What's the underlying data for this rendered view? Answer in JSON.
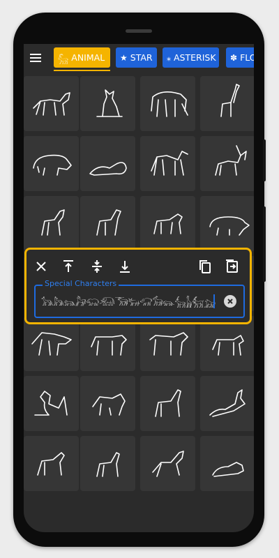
{
  "tabs": [
    {
      "icon": "goat-icon",
      "glyph": "𓃵",
      "label": "ANIMAL",
      "active": true
    },
    {
      "icon": "star-icon",
      "glyph": "★",
      "label": "STAR",
      "active": false
    },
    {
      "icon": "asterisk-icon",
      "glyph": "⁎",
      "label": "ASTERISK",
      "active": false
    },
    {
      "icon": "flower-icon",
      "glyph": "✽",
      "label": "FLO",
      "active": false
    }
  ],
  "grid": {
    "items": [
      {
        "icon": "jackal-icon"
      },
      {
        "icon": "seated-cat-icon"
      },
      {
        "icon": "elephant-icon"
      },
      {
        "icon": "giraffe-icon"
      },
      {
        "icon": "hippopotamus-icon"
      },
      {
        "icon": "lying-lion-icon"
      },
      {
        "icon": "monkey-icon"
      },
      {
        "icon": "ibex-icon"
      },
      {
        "icon": "horse-icon"
      },
      {
        "icon": "donkey-icon"
      },
      {
        "icon": "hound-icon"
      },
      {
        "icon": "pig-icon"
      },
      {
        "icon": "leaping-antelope-icon"
      },
      {
        "icon": "lying-oryx-icon"
      },
      {
        "icon": "lying-bull-icon"
      },
      {
        "icon": "gazelle-icon"
      },
      {
        "icon": "hartebeest-icon"
      },
      {
        "icon": "cow-icon"
      },
      {
        "icon": "ox-icon"
      },
      {
        "icon": "calf-icon"
      },
      {
        "icon": "seated-figure-icon"
      },
      {
        "icon": "cow-suckling-calf-icon"
      },
      {
        "icon": "set-animal-icon"
      },
      {
        "icon": "recumbent-jackal-icon"
      },
      {
        "icon": "giraffe-standing-icon"
      },
      {
        "icon": "antelope-icon"
      },
      {
        "icon": "deer-icon"
      },
      {
        "icon": "dog-icon"
      }
    ]
  },
  "panel": {
    "buttons": [
      {
        "icon": "close-icon",
        "name": "close-button"
      },
      {
        "icon": "align-top-icon",
        "name": "move-top-button"
      },
      {
        "icon": "align-middle-icon",
        "name": "move-middle-button"
      },
      {
        "icon": "align-bottom-icon",
        "name": "move-bottom-button"
      },
      {
        "icon": "copy-icon",
        "name": "copy-button"
      },
      {
        "icon": "open-in-icon",
        "name": "share-button"
      }
    ],
    "field_label": "Special Characters",
    "field_value": "𓃥𓃦𓃬𓃗𓃯𓃰𓃝𓃒𓃟𓃘𓃮𓃲𓃱𓃶𓃷𓃸𓃹𓃺𓃻𓃼𓃽𓃾𓃿",
    "clear_icon": "clear-icon"
  },
  "colors": {
    "accent": "#f5b400",
    "tab_blue": "#1f63d9",
    "field_blue": "#1e6be0",
    "background": "#2b2b2b",
    "cell": "#363636"
  }
}
